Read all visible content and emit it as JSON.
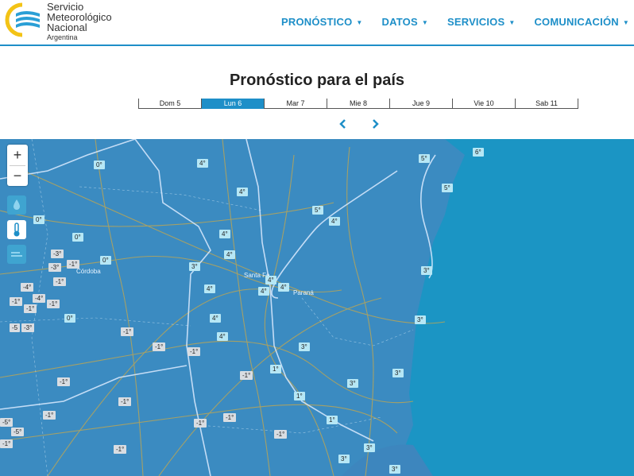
{
  "header": {
    "logo_lines": [
      "Servicio",
      "Meteorológico",
      "Nacional"
    ],
    "logo_sub": "Argentina",
    "nav": [
      "PRONÓSTICO",
      "DATOS",
      "SERVICIOS",
      "COMUNICACIÓN"
    ]
  },
  "page": {
    "title": "Pronóstico para el país"
  },
  "days": [
    "Dom 5",
    "Lun 6",
    "Mar 7",
    "Mie 8",
    "Jue 9",
    "Vie 10",
    "Sab 11"
  ],
  "active_day": "Lun 6",
  "map": {
    "zoom_in": "+",
    "zoom_out": "−",
    "cities": [
      "Córdoba",
      "Santa Fe",
      "Paraná"
    ],
    "temperatures": [
      "6°",
      "5°",
      "5°",
      "0°",
      "4°",
      "4°",
      "5°",
      "4°",
      "0°",
      "0°",
      "4°",
      "-3°",
      "-1°",
      "0°",
      "4°",
      "3°",
      "-3°",
      "-1°",
      "4°",
      "4°",
      "-4°",
      "-4°",
      "-1°",
      "4°",
      "4°",
      "-1°",
      "-1°",
      "0°",
      "4°",
      "3°",
      "3°",
      "-5",
      "-3°",
      "-1°",
      "-1°",
      "4°",
      "-1°",
      "3°",
      "-1°",
      "1°",
      "-1°",
      "3°",
      "3°",
      "-1°",
      "1°",
      "-1°",
      "-1°",
      "-1°",
      "-1°",
      "1°",
      "-5°",
      "-1°",
      "-5°",
      "-1°",
      "3°",
      "3°",
      "3°"
    ]
  }
}
